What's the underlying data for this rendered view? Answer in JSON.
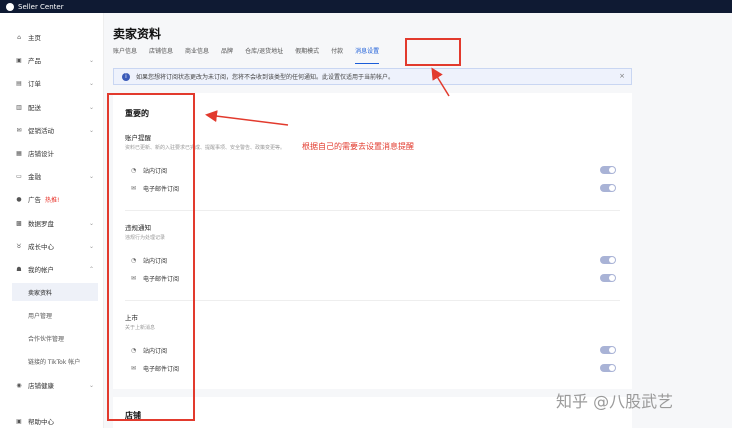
{
  "topbar": {
    "app_name": "Seller Center"
  },
  "sidebar": {
    "items": [
      {
        "label": "主页",
        "icon": "home-icon",
        "glyph": "⌂",
        "chevron": false
      },
      {
        "label": "产品",
        "icon": "product-icon",
        "glyph": "▣",
        "chevron": true
      },
      {
        "label": "订单",
        "icon": "order-icon",
        "glyph": "▤",
        "chevron": true
      },
      {
        "label": "配送",
        "icon": "shipping-icon",
        "glyph": "▥",
        "chevron": true
      },
      {
        "label": "促销活动",
        "icon": "promotion-icon",
        "glyph": "✉",
        "chevron": true
      },
      {
        "label": "店铺设计",
        "icon": "store-design-icon",
        "glyph": "▦",
        "chevron": false
      },
      {
        "label": "金融",
        "icon": "finance-icon",
        "glyph": "▭",
        "chevron": true
      },
      {
        "label": "广告",
        "icon": "ads-icon",
        "glyph": "●",
        "chevron": false,
        "badge": "热推!"
      },
      {
        "label": "数据罗盘",
        "icon": "data-compass-icon",
        "glyph": "▩",
        "chevron": true
      },
      {
        "label": "成长中心",
        "icon": "growth-icon",
        "glyph": "♉",
        "chevron": true
      },
      {
        "label": "我的帐户",
        "icon": "account-icon",
        "glyph": "☗",
        "chevron": true,
        "chevron_up": true
      },
      {
        "label": "店铺健康",
        "icon": "store-health-icon",
        "glyph": "◉",
        "chevron": true
      },
      {
        "label": "帮助中心",
        "icon": "help-icon",
        "glyph": "▣",
        "chevron": false
      }
    ],
    "sub_items": [
      "卖家资料",
      "用户管理",
      "合作伙伴管理",
      "链接的 TikTok 帐户"
    ]
  },
  "page": {
    "title": "卖家资料",
    "tabs": [
      "账户信息",
      "店铺信息",
      "商业信息",
      "品牌",
      "仓库/退货地址",
      "假期模式",
      "付款",
      "消息设置"
    ],
    "active_tab": 7
  },
  "notice": {
    "text": "如果您想将订阅状态更改为未订阅，您将不会收到该类型的任何通知。此设置仅适用于当前帐户。",
    "close": "×"
  },
  "settings": {
    "section_title": "重要的",
    "groups": [
      {
        "title": "账户提醒",
        "desc": "资料已更新、新的入驻要求已完成、提醒事项、安全警告、政策变更等。",
        "rows": [
          {
            "label": "站内订阅",
            "icon": "bell-icon",
            "glyph": "◔"
          },
          {
            "label": "电子邮件订阅",
            "icon": "mail-icon",
            "glyph": "✉"
          }
        ]
      },
      {
        "title": "违规通知",
        "desc": "违规行为处理记录",
        "rows": [
          {
            "label": "站内订阅",
            "icon": "bell-icon",
            "glyph": "◔"
          },
          {
            "label": "电子邮件订阅",
            "icon": "mail-icon",
            "glyph": "✉"
          }
        ]
      },
      {
        "title": "上市",
        "desc": "关于上新消息",
        "rows": [
          {
            "label": "站内订阅",
            "icon": "bell-icon",
            "glyph": "◔"
          },
          {
            "label": "电子邮件订阅",
            "icon": "mail-icon",
            "glyph": "✉"
          }
        ]
      }
    ],
    "next_section_title": "店铺"
  },
  "annotation": {
    "text": "根据自己的需要去设置消息提醒"
  },
  "watermark": "知乎 @八股武艺",
  "colors": {
    "accent": "#1a5cd8",
    "annotation_red": "#e23a2d",
    "toggle_on": "#a9b3d6",
    "topbar": "#0f1a33"
  }
}
